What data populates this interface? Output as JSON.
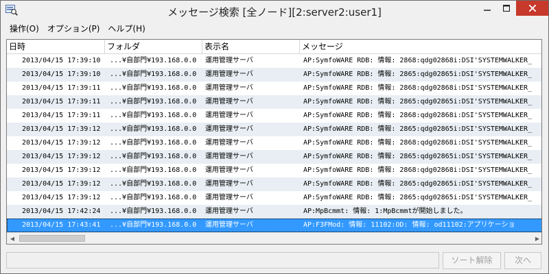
{
  "window": {
    "title": "メッセージ検索 [全ノード][2:server2:user1]"
  },
  "menu": {
    "items": [
      "操作(O)",
      "オプション(P)",
      "ヘルプ(H)"
    ]
  },
  "table": {
    "columns": [
      "日時",
      "フォルダ",
      "表示名",
      "メッセージ"
    ],
    "rows": [
      {
        "date": "2013/04/15 17:39:10",
        "folder": "...¥自部門¥193.168.0.0",
        "name": "運用管理サーバ",
        "message": "AP:SymfoWARE RDB: 情報: 2868:qdg02868i:DSI'SYSTEMWALKER_"
      },
      {
        "date": "2013/04/15 17:39:10",
        "folder": "...¥自部門¥193.168.0.0",
        "name": "運用管理サーバ",
        "message": "AP:SymfoWARE RDB: 情報: 2865:qdg02865i:DSI'SYSTEMWALKER_"
      },
      {
        "date": "2013/04/15 17:39:11",
        "folder": "...¥自部門¥193.168.0.0",
        "name": "運用管理サーバ",
        "message": "AP:SymfoWARE RDB: 情報: 2868:qdg02868i:DSI'SYSTEMWALKER_"
      },
      {
        "date": "2013/04/15 17:39:11",
        "folder": "...¥自部門¥193.168.0.0",
        "name": "運用管理サーバ",
        "message": "AP:SymfoWARE RDB: 情報: 2865:qdg02865i:DSI'SYSTEMWALKER_"
      },
      {
        "date": "2013/04/15 17:39:11",
        "folder": "...¥自部門¥193.168.0.0",
        "name": "運用管理サーバ",
        "message": "AP:SymfoWARE RDB: 情報: 2868:qdg02868i:DSI'SYSTEMWALKER_"
      },
      {
        "date": "2013/04/15 17:39:12",
        "folder": "...¥自部門¥193.168.0.0",
        "name": "運用管理サーバ",
        "message": "AP:SymfoWARE RDB: 情報: 2865:qdg02865i:DSI'SYSTEMWALKER_"
      },
      {
        "date": "2013/04/15 17:39:12",
        "folder": "...¥自部門¥193.168.0.0",
        "name": "運用管理サーバ",
        "message": "AP:SymfoWARE RDB: 情報: 2868:qdg02868i:DSI'SYSTEMWALKER_"
      },
      {
        "date": "2013/04/15 17:39:12",
        "folder": "...¥自部門¥193.168.0.0",
        "name": "運用管理サーバ",
        "message": "AP:SymfoWARE RDB: 情報: 2865:qdg02865i:DSI'SYSTEMWALKER_"
      },
      {
        "date": "2013/04/15 17:39:12",
        "folder": "...¥自部門¥193.168.0.0",
        "name": "運用管理サーバ",
        "message": "AP:SymfoWARE RDB: 情報: 2868:qdg02868i:DSI'SYSTEMWALKER_"
      },
      {
        "date": "2013/04/15 17:39:12",
        "folder": "...¥自部門¥193.168.0.0",
        "name": "運用管理サーバ",
        "message": "AP:SymfoWARE RDB: 情報: 2865:qdg02865i:DSI'SYSTEMWALKER_"
      },
      {
        "date": "2013/04/15 17:39:12",
        "folder": "...¥自部門¥193.168.0.0",
        "name": "運用管理サーバ",
        "message": "AP:SymfoWARE RDB: 情報: 2865:qdg02865i:DSI'SYSTEMWALKER_"
      },
      {
        "date": "2013/04/15 17:42:24",
        "folder": "...¥自部門¥193.168.0.0",
        "name": "運用管理サーバ",
        "message": "AP:MpBcmmt: 情報: 1:MpBcmmtが開始しました。"
      },
      {
        "date": "2013/04/15 17:43:41",
        "folder": "...¥自部門¥193.168.0.0",
        "name": "運用管理サーバ",
        "message": "AP:F3FMod: 情報: 11102:OD: 情報: od11102:アプリケーショ"
      }
    ]
  },
  "buttons": {
    "sort_reset": "ソート解除",
    "next": "次へ"
  },
  "colors": {
    "selection": "#3399ff",
    "alt_row": "#e8eef3",
    "close": "#c7392b"
  }
}
